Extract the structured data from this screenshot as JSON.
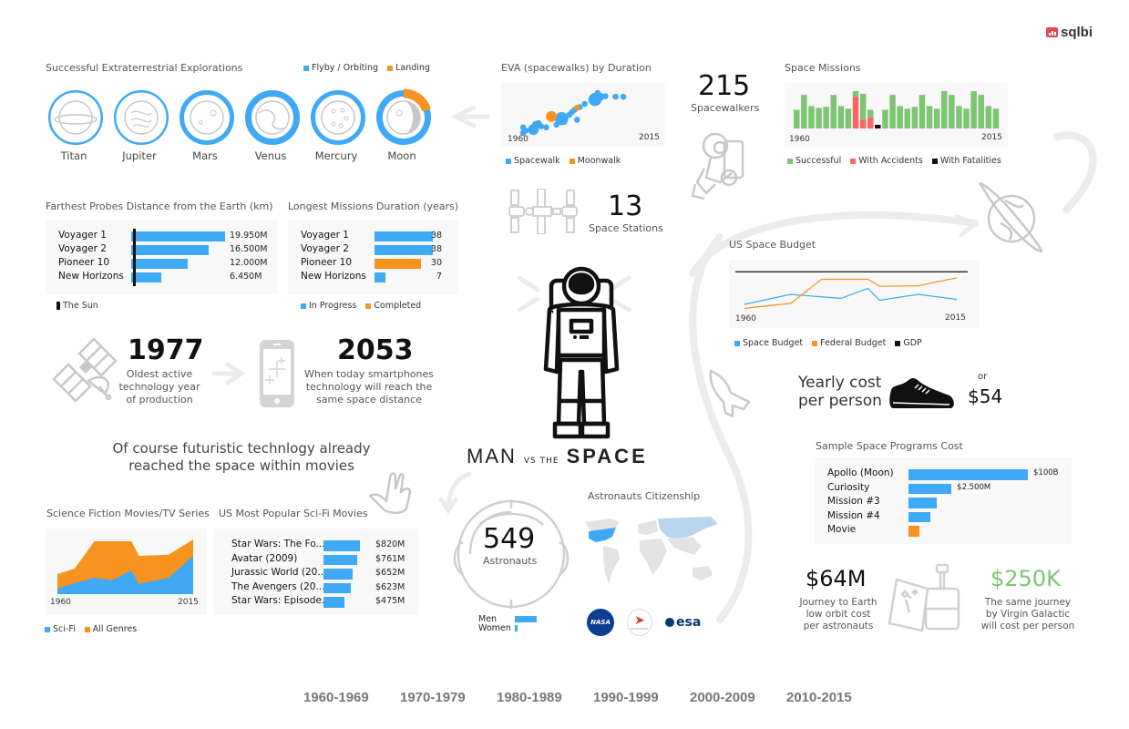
{
  "brand": {
    "logo_text": "sqlbi",
    "logo_color": "#e04b4b"
  },
  "colors": {
    "blue": "#3fa9f5",
    "orange": "#f7931e",
    "green": "#7dc473",
    "red": "#ff6363",
    "black": "#111111",
    "light_blue": "#b7d5ec",
    "map_gray": "#e3e3e3",
    "icon_gray": "#c8c8c8"
  },
  "explorations": {
    "title": "Successful Extraterrestrial Explorations",
    "legend": [
      {
        "label": "Flyby / Orbiting",
        "color": "#3fa9f5"
      },
      {
        "label": "Landing",
        "color": "#f7931e"
      }
    ],
    "bodies": [
      {
        "name": "Titan",
        "icon": "planet-with-ring-icon",
        "flyby": 1,
        "landing": 0,
        "intensity": 1
      },
      {
        "name": "Jupiter",
        "icon": "jupiter-swirl-icon",
        "flyby": 1,
        "landing": 0,
        "intensity": 1
      },
      {
        "name": "Mars",
        "icon": "mars-crater-icon",
        "flyby": 1,
        "landing": 0,
        "intensity": 2
      },
      {
        "name": "Venus",
        "icon": "venus-icon",
        "flyby": 1,
        "landing": 0,
        "intensity": 3
      },
      {
        "name": "Mercury",
        "icon": "mercury-crater-icon",
        "flyby": 1,
        "landing": 0,
        "intensity": 2
      },
      {
        "name": "Moon",
        "icon": "moon-icon",
        "flyby": 0.8,
        "landing": 0.2,
        "intensity": 3
      }
    ]
  },
  "probes": {
    "title": "Farthest Probes Distance from the Earth (km)",
    "legend": [
      {
        "label": "The Sun",
        "color": "#111111"
      }
    ],
    "rows": [
      {
        "name": "Voyager 1",
        "value": 19950,
        "label": "19.950M"
      },
      {
        "name": "Voyager 2",
        "value": 16500,
        "label": "16.500M"
      },
      {
        "name": "Pioneer 10",
        "value": 12000,
        "label": "12.000M"
      },
      {
        "name": "New Horizons",
        "value": 6450,
        "label": "6.450M"
      }
    ],
    "max": 19950
  },
  "durations": {
    "title": "Longest Missions Duration (years)",
    "legend": [
      {
        "label": "In Progress",
        "color": "#3fa9f5"
      },
      {
        "label": "Completed",
        "color": "#f7931e"
      }
    ],
    "rows": [
      {
        "name": "Voyager 1",
        "value": 38,
        "label": "38",
        "status": "in_progress"
      },
      {
        "name": "Voyager 2",
        "value": 38,
        "label": "38",
        "status": "in_progress"
      },
      {
        "name": "Pioneer 10",
        "value": 30,
        "label": "30",
        "status": "completed"
      },
      {
        "name": "New Horizons",
        "value": 7,
        "label": "7",
        "status": "in_progress"
      }
    ],
    "max": 38
  },
  "eva": {
    "title": "EVA (spacewalks) by Duration",
    "x_start": "1960",
    "x_end": "2015",
    "legend": [
      {
        "label": "Spacewalk",
        "color": "#3fa9f5"
      },
      {
        "label": "Moonwalk",
        "color": "#f7931e"
      }
    ]
  },
  "spacewalkers": {
    "value": "215",
    "label": "Spacewalkers"
  },
  "stations": {
    "value": "13",
    "label": "Space Stations"
  },
  "missions": {
    "title": "Space Missions",
    "x_start": "1960",
    "x_end": "2015",
    "legend": [
      {
        "label": "Successful",
        "color": "#7dc473"
      },
      {
        "label": "With Accidents",
        "color": "#ff6363"
      },
      {
        "label": "With Fatalities",
        "color": "#111111"
      }
    ]
  },
  "budget": {
    "title": "US Space Budget",
    "x_start": "1960",
    "x_end": "2015",
    "legend": [
      {
        "label": "Space Budget",
        "color": "#3fa9f5"
      },
      {
        "label": "Federal Budget",
        "color": "#f7931e"
      },
      {
        "label": "GDP",
        "color": "#111111"
      }
    ]
  },
  "yearly_cost": {
    "label_line1": "Yearly cost",
    "label_line2": "per person",
    "or": "or",
    "value": "$54",
    "icon": "sneaker-icon"
  },
  "oldest_tech": {
    "value": "1977",
    "line1": "Oldest active",
    "line2": "technology year",
    "line3": "of production"
  },
  "smartphone": {
    "value": "2053",
    "line1": "When today smartphones",
    "line2": "technology will reach the",
    "line3": "same space distance"
  },
  "movies_statement": {
    "line1": "Of course futuristic technlogy already",
    "line2": "reached the space within movies"
  },
  "headline": {
    "man": "MAN",
    "vs": "VS THE",
    "space": "SPACE"
  },
  "astronauts": {
    "value": "549",
    "label": "Astronauts",
    "gender": [
      {
        "label": "Men",
        "value": 0.89
      },
      {
        "label": "Women",
        "value": 0.11
      }
    ]
  },
  "citizenship": {
    "title": "Astronauts Citizenship",
    "agencies": [
      "NASA",
      "Roscosmos",
      "esa"
    ],
    "roscosmos_caption": "РОСКОСМОС"
  },
  "programs_cost": {
    "title": "Sample Space Programs Cost",
    "rows": [
      {
        "name": "Apollo (Moon)",
        "value": 100,
        "label": "$100B",
        "color": "#3fa9f5"
      },
      {
        "name": "Curiosity",
        "value": 36,
        "label": "$2.500M",
        "color": "#3fa9f5"
      },
      {
        "name": "Mission #3",
        "value": 24,
        "label": "",
        "color": "#3fa9f5"
      },
      {
        "name": "Mission #4",
        "value": 18,
        "label": "",
        "color": "#3fa9f5"
      },
      {
        "name": "Movie",
        "value": 9,
        "label": "",
        "color": "#f7931e"
      }
    ]
  },
  "journey_cost": {
    "value": "$64M",
    "line1": "Journey to Earth",
    "line2": "low orbit cost",
    "line3": "per astronauts"
  },
  "virgin_cost": {
    "value": "$250K",
    "line1": "The same journey",
    "line2": "by Virgin Galactic",
    "line3": "will cost per person",
    "color": "#7dc473"
  },
  "scifi": {
    "title": "Science Fiction Movies/TV Series",
    "x_start": "1960",
    "x_end": "2015",
    "legend": [
      {
        "label": "Sci-Fi",
        "color": "#3fa9f5"
      },
      {
        "label": "All Genres",
        "color": "#f7931e"
      }
    ]
  },
  "popular_movies": {
    "title": "US Most Popular Sci-Fi Movies",
    "rows": [
      {
        "name": "Star Wars: The Fo...",
        "value": 820,
        "label": "$820M"
      },
      {
        "name": "Avatar (2009)",
        "value": 761,
        "label": "$761M"
      },
      {
        "name": "Jurassic World (20...",
        "value": 652,
        "label": "$652M"
      },
      {
        "name": "The Avengers (20...",
        "value": 623,
        "label": "$623M"
      },
      {
        "name": "Star Wars: Episode...",
        "value": 475,
        "label": "$475M"
      }
    ],
    "max": 820
  },
  "decades": [
    "1960-1969",
    "1970-1979",
    "1980-1989",
    "1990-1999",
    "2000-2009",
    "2010-2015"
  ],
  "chart_data": [
    {
      "type": "scatter",
      "title": "EVA (spacewalks) by Duration",
      "xlabel": "",
      "ylabel": "",
      "x_range": [
        1960,
        2015
      ],
      "series": [
        {
          "name": "Spacewalk",
          "points": [
            [
              1965,
              1.2,
              1
            ],
            [
              1965,
              2.2,
              1
            ],
            [
              1966,
              1.6,
              1
            ],
            [
              1969,
              1.8,
              3
            ],
            [
              1970,
              2.6,
              2
            ],
            [
              1971,
              3.0,
              1
            ],
            [
              1972,
              2.4,
              1
            ],
            [
              1974,
              2.2,
              1
            ],
            [
              1978,
              2.7,
              1
            ],
            [
              1980,
              3.8,
              4
            ],
            [
              1981,
              3.2,
              1
            ],
            [
              1983,
              4.5,
              1
            ],
            [
              1984,
              5.0,
              1
            ],
            [
              1985,
              5.4,
              1
            ],
            [
              1986,
              3.6,
              1
            ],
            [
              1987,
              5.9,
              1
            ],
            [
              1989,
              6.5,
              1
            ],
            [
              1993,
              7.3,
              4
            ],
            [
              1994,
              8.5,
              1
            ],
            [
              1995,
              7.8,
              2
            ],
            [
              1997,
              7.9,
              1
            ],
            [
              2001,
              7.8,
              1
            ],
            [
              2004,
              7.8,
              1
            ]
          ]
        },
        {
          "name": "Moonwalk",
          "points": [
            [
              1976,
              4.2,
              3
            ],
            [
              1986,
              5.8,
              1
            ]
          ]
        }
      ]
    },
    {
      "type": "bar",
      "title": "Space Missions",
      "stacked": true,
      "x_range": [
        1960,
        2015
      ],
      "series": [
        {
          "name": "Successful",
          "values": [
            5,
            9,
            6,
            5.5,
            5.8,
            9,
            6,
            5.3,
            1.5,
            7,
            2,
            0,
            5,
            9,
            6,
            5.3,
            5.8,
            9,
            6,
            5.3,
            10,
            9,
            6,
            5.3,
            10,
            9,
            6,
            5.3
          ]
        },
        {
          "name": "With Accidents",
          "values": [
            0,
            0,
            0,
            0,
            0,
            0,
            0,
            0,
            8.5,
            2.3,
            3,
            0,
            0,
            0,
            0,
            0,
            0,
            0,
            0,
            0,
            0,
            0,
            0,
            0,
            0,
            0,
            0,
            0
          ]
        },
        {
          "name": "With Fatalities",
          "values": [
            0,
            0,
            0,
            0,
            0,
            0,
            0,
            0,
            0,
            0,
            0,
            1,
            0,
            0,
            0,
            0,
            0,
            0,
            0,
            0,
            0,
            0,
            0,
            0,
            0,
            0,
            0,
            0
          ]
        }
      ]
    },
    {
      "type": "line",
      "title": "US Space Budget",
      "x": [
        1960,
        1972,
        1980,
        1985,
        1992,
        1995,
        2005,
        2015
      ],
      "series": [
        {
          "name": "Space Budget",
          "values": [
            2,
            4,
            3.5,
            3.2,
            5.2,
            2.8,
            4,
            3
          ]
        },
        {
          "name": "Federal Budget",
          "values": [
            1.2,
            2.2,
            7,
            7,
            7,
            5.6,
            5.7,
            7.3
          ]
        },
        {
          "name": "GDP",
          "values": [
            8.5,
            8.5,
            8.5,
            8.5,
            8.5,
            8.5,
            8.5,
            8.5
          ]
        }
      ]
    },
    {
      "type": "area",
      "title": "Science Fiction Movies/TV Series",
      "x": [
        1960,
        1967,
        1975,
        1982,
        1990,
        1993,
        2005,
        2015
      ],
      "series": [
        {
          "name": "Sci-Fi",
          "values": [
            1.5,
            3,
            4.5,
            3.8,
            6.5,
            2.8,
            4.5,
            10.5
          ]
        },
        {
          "name": "All Genres",
          "values": [
            5.5,
            7,
            14.5,
            14.5,
            14.5,
            10.5,
            10.8,
            15
          ]
        }
      ]
    }
  ]
}
